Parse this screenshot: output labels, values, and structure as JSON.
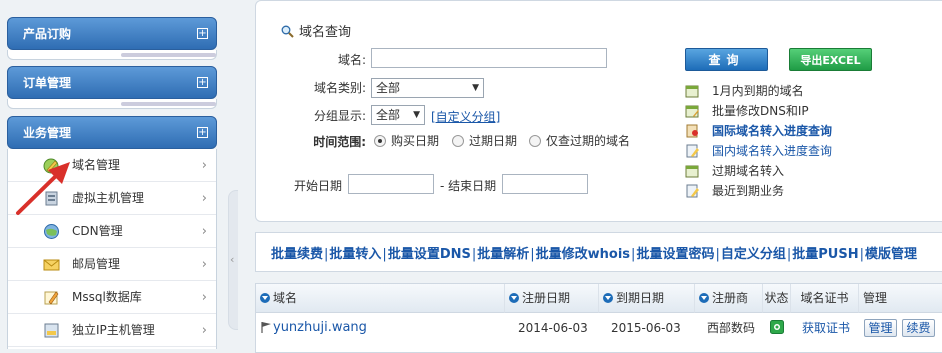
{
  "sidebar": {
    "panels": [
      {
        "title": "产品订购",
        "toggle": "+"
      },
      {
        "title": "订单管理",
        "toggle": "+"
      },
      {
        "title": "业务管理",
        "toggle": "+"
      }
    ],
    "menu": [
      {
        "label": "域名管理",
        "icon": "globe-pencil-icon",
        "chevron": "›"
      },
      {
        "label": "虚拟主机管理",
        "icon": "server-icon",
        "chevron": "›"
      },
      {
        "label": "CDN管理",
        "icon": "cdn-globe-icon",
        "chevron": "›"
      },
      {
        "label": "邮局管理",
        "icon": "mail-icon",
        "chevron": "›"
      },
      {
        "label": "Mssql数据库",
        "icon": "database-pencil-icon",
        "chevron": "›"
      },
      {
        "label": "独立IP主机管理",
        "icon": "ip-host-icon",
        "chevron": "›"
      }
    ],
    "collapse_glyph": "‹",
    "annotation_color": "#d9302a"
  },
  "query": {
    "title": "域名查询",
    "domain_label": "域名:",
    "domain_value": "",
    "type_label": "域名类别:",
    "type_value": "全部",
    "group_label": "分组显示:",
    "group_value": "全部",
    "custom_group_link": "[自定义分组]",
    "time_label": "时间范围:",
    "radios": [
      {
        "label": "购买日期",
        "checked": true
      },
      {
        "label": "过期日期",
        "checked": false
      },
      {
        "label": "仅查过期的域名",
        "checked": false
      }
    ],
    "start_label": "开始日期",
    "end_label": "- 结束日期",
    "query_button": "查询",
    "export_button": "导出EXCEL",
    "links": [
      {
        "label": "1月内到期的域名",
        "style": "plain"
      },
      {
        "label": "批量修改DNS和IP",
        "style": "plain"
      },
      {
        "label": "国际域名转入进度查询",
        "style": "blue-bold"
      },
      {
        "label": "国内域名转入进度查询",
        "style": "blue"
      },
      {
        "label": "过期域名转入",
        "style": "plain"
      },
      {
        "label": "最近到期业务",
        "style": "plain"
      }
    ]
  },
  "batch": {
    "actions": [
      "批量续费",
      "批量转入",
      "批量设置DNS",
      "批量解析",
      "批量修改whois",
      "批量设置密码",
      "自定义分组",
      "批量PUSH",
      "模版管理"
    ],
    "separator": "|"
  },
  "table": {
    "headers": {
      "domain": "域名",
      "reg_date": "注册日期",
      "exp_date": "到期日期",
      "registrar": "注册商",
      "status": "状态",
      "cert": "域名证书",
      "manage": "管理"
    },
    "rows": [
      {
        "domain": "yunzhuji.wang",
        "reg_date": "2014-06-03",
        "exp_date": "2015-06-03",
        "registrar": "西部数码",
        "status_color": "#2ea84a",
        "cert_link": "获取证书",
        "manage_btn": "管理",
        "renew_btn": "续费"
      }
    ]
  }
}
